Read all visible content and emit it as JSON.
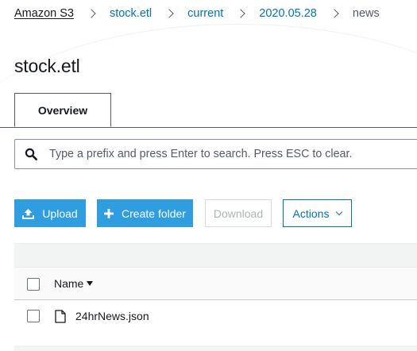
{
  "breadcrumb": {
    "items": [
      {
        "label": "Amazon S3"
      },
      {
        "label": "stock.etl"
      },
      {
        "label": "current"
      },
      {
        "label": "2020.05.28"
      }
    ],
    "current": "news",
    "separator_icon": "chevron-right-icon"
  },
  "page": {
    "title": "stock.etl"
  },
  "tabs": [
    {
      "label": "Overview",
      "active": true
    }
  ],
  "search": {
    "placeholder": "Type a prefix and press Enter to search. Press ESC to clear.",
    "value": "",
    "icon": "search-icon"
  },
  "toolbar": {
    "upload_label": "Upload",
    "upload_icon": "upload-icon",
    "create_folder_label": "Create folder",
    "create_folder_icon": "plus-icon",
    "download_label": "Download",
    "download_disabled": true,
    "actions_label": "Actions",
    "actions_icon": "chevron-down-icon"
  },
  "table": {
    "columns": [
      {
        "label": "Name",
        "sort": "descending"
      }
    ],
    "rows": [
      {
        "name": "24hrNews.json",
        "icon": "file-icon",
        "selected": false
      }
    ]
  },
  "colors": {
    "primary_button": "#2e9ee0",
    "link": "#0073bb",
    "text": "#16191f",
    "disabled_text": "#aab7b8"
  }
}
